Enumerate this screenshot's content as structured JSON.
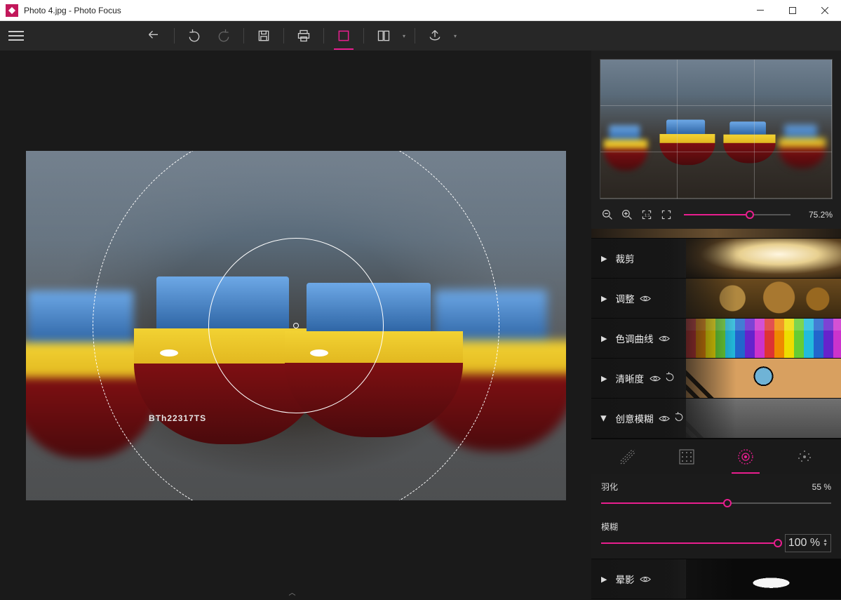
{
  "window": {
    "title": "Photo 4.jpg - Photo Focus"
  },
  "image": {
    "boat_registration": "BTh22317TS"
  },
  "toolbar": {
    "icons": [
      "menu",
      "undo-group",
      "undo",
      "redo",
      "save",
      "print",
      "frame",
      "compare",
      "export"
    ],
    "active": "frame"
  },
  "zoom": {
    "value": "75.2%",
    "percent": 75.2
  },
  "accordion": {
    "crop": {
      "label": "裁剪",
      "expanded": false,
      "has_eye": false
    },
    "adjust": {
      "label": "调整",
      "expanded": false,
      "has_eye": true
    },
    "tone_curve": {
      "label": "色调曲线",
      "expanded": false,
      "has_eye": true
    },
    "clarity": {
      "label": "清晰度",
      "expanded": false,
      "has_eye": true,
      "has_undo": true
    },
    "creative_blur": {
      "label": "创意模糊",
      "expanded": true,
      "has_eye": true,
      "has_undo": true
    },
    "vignette": {
      "label": "晕影",
      "expanded": false,
      "has_eye": true
    }
  },
  "blur_mode": {
    "tabs": [
      "linear",
      "halftone",
      "radial",
      "scatter"
    ],
    "active": "radial"
  },
  "sliders": {
    "feather": {
      "label": "羽化",
      "value": "55 %",
      "percent": 55
    },
    "blur": {
      "label": "模糊",
      "value": "100 %",
      "percent": 100
    }
  }
}
